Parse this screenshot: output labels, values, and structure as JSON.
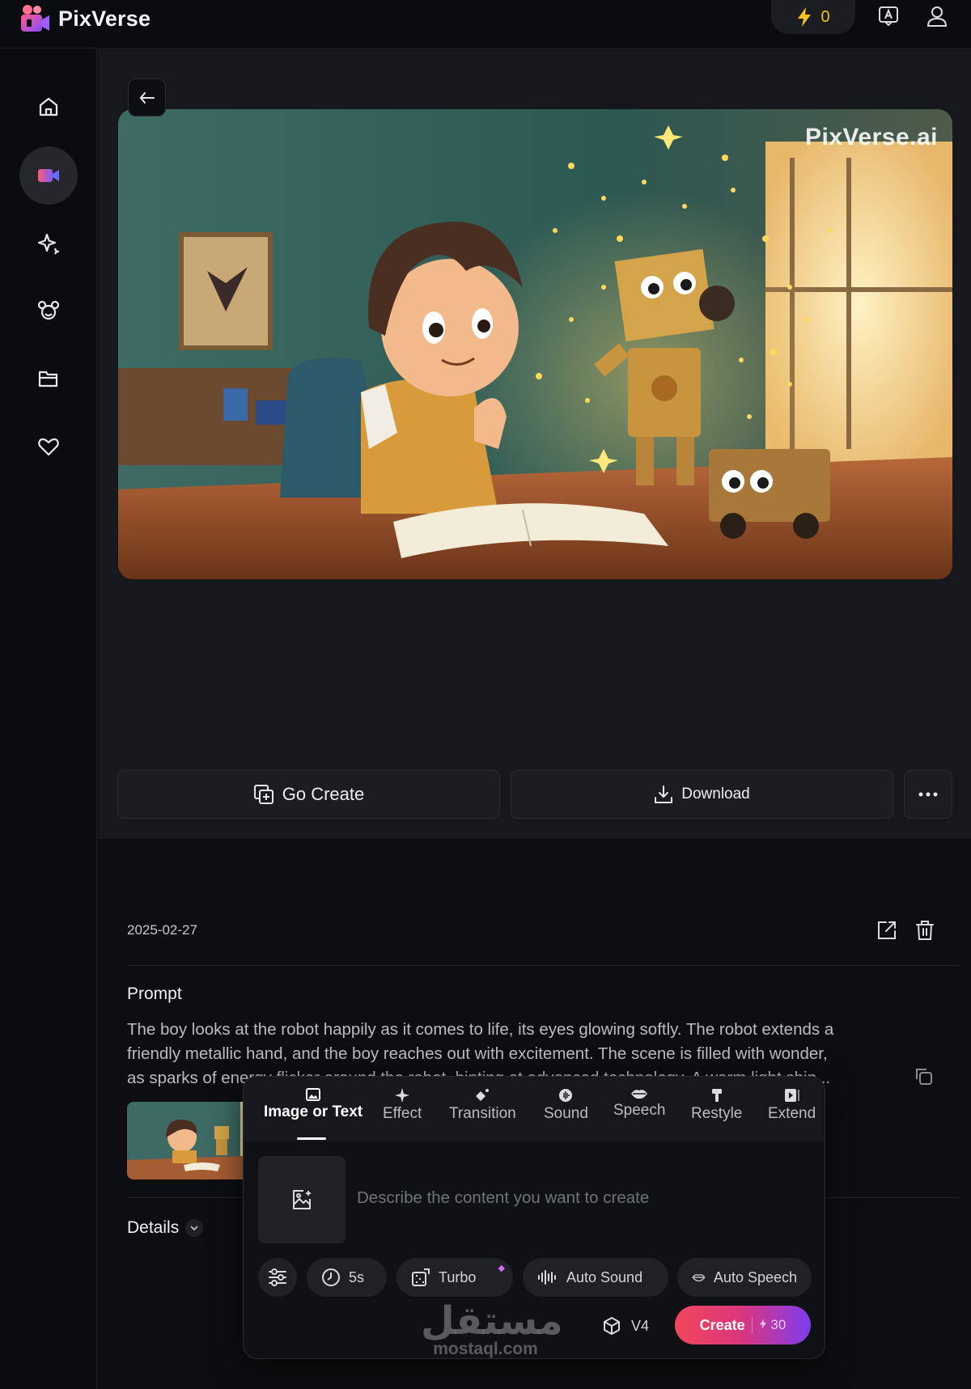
{
  "app": {
    "name": "PixVerse",
    "credits": "0"
  },
  "video": {
    "watermark": "PixVerse.ai"
  },
  "actions": {
    "go_create": "Go Create",
    "download": "Download"
  },
  "meta": {
    "date": "2025-02-27"
  },
  "prompt": {
    "title": "Prompt",
    "line1": "The boy looks at the robot happily as it comes to life, its eyes glowing softly. The robot extends a",
    "line2": "friendly metallic hand, and the boy reaches out with excitement. The scene is filled with wonder,",
    "line3": "as sparks of energy flicker around the robot, hinting at advanced technology. A warm light shin..."
  },
  "details": {
    "label": "Details"
  },
  "panel": {
    "tabs": [
      {
        "label": "Image or Text",
        "icon": "image-icon"
      },
      {
        "label": "Effect",
        "icon": "sparkle-icon"
      },
      {
        "label": "Transition",
        "icon": "transition-icon"
      },
      {
        "label": "Sound",
        "icon": "sound-icon"
      },
      {
        "label": "Speech",
        "icon": "lips-icon"
      },
      {
        "label": "Restyle",
        "icon": "brush-icon"
      },
      {
        "label": "Extend",
        "icon": "extend-icon"
      }
    ],
    "placeholder": "Describe the content you want to create",
    "options": {
      "duration": "5s",
      "turbo": "Turbo",
      "auto_sound": "Auto Sound",
      "auto_speech": "Auto Speech"
    },
    "model": "V4",
    "create_label": "Create",
    "create_cost": "30"
  },
  "watermark_site": {
    "arabic": "مستقل",
    "latin": "mostaql.com"
  },
  "colors": {
    "accent_gradient_start": "#f2465b",
    "accent_gradient_end": "#7e3cf0",
    "credit": "#f5c518"
  }
}
